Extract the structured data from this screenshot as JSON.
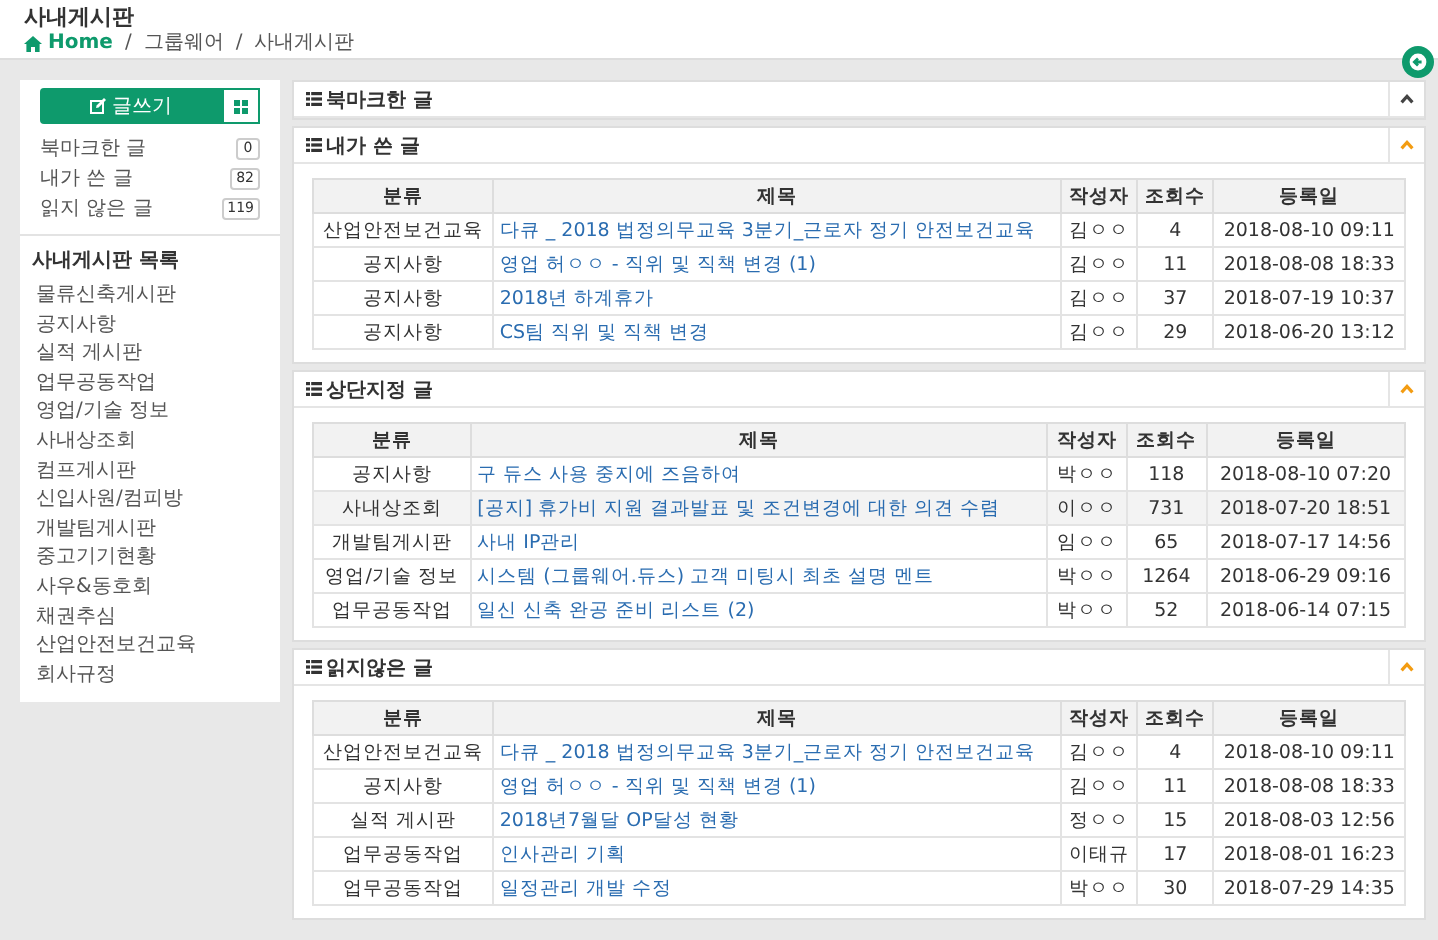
{
  "header": {
    "title": "사내게시판",
    "separator": "/",
    "breadcrumb": [
      {
        "label": "Home",
        "kind": "home"
      },
      {
        "label": "그룹웨어",
        "kind": "text"
      },
      {
        "label": "사내게시판",
        "kind": "text"
      }
    ]
  },
  "sidebar": {
    "write_button": "글쓰기",
    "counters": [
      {
        "label": "북마크한 글",
        "count": "0"
      },
      {
        "label": "내가 쓴 글",
        "count": "82"
      },
      {
        "label": "읽지 않은 글",
        "count": "119"
      }
    ],
    "board_list_title": "사내게시판 목록",
    "boards": [
      "물류신축게시판",
      "공지사항",
      "실적 게시판",
      "업무공동작업",
      "영업/기술 정보",
      "사내상조회",
      "컴프게시판",
      "신입사원/컴피방",
      "개발팀게시판",
      "중고기기현황",
      "사우&동호회",
      "채권추심",
      "산업안전보건교육",
      "회사규정"
    ]
  },
  "panels": [
    {
      "title": "북마크한 글",
      "expanded": false
    },
    {
      "title": "내가 쓴 글",
      "expanded": true,
      "table": {
        "columns": [
          "분류",
          "제목",
          "작성자",
          "조회수",
          "등록일"
        ],
        "rows": [
          {
            "selected": false,
            "cells": [
              "산업안전보건교육",
              "다큐 _ 2018 법정의무교육 3분기_근로자 정기 안전보건교육",
              "김ㅇㅇ",
              "4",
              "2018-08-10 09:11"
            ]
          },
          {
            "selected": false,
            "cells": [
              "공지사항",
              "영업 허ㅇㅇ - 직위 및 직책 변경 (1)",
              "김ㅇㅇ",
              "11",
              "2018-08-08 18:33"
            ]
          },
          {
            "selected": false,
            "cells": [
              "공지사항",
              "2018년 하계휴가",
              "김ㅇㅇ",
              "37",
              "2018-07-19 10:37"
            ]
          },
          {
            "selected": false,
            "cells": [
              "공지사항",
              "CS팀 직위 및 직책 변경",
              "김ㅇㅇ",
              "29",
              "2018-06-20 13:12"
            ]
          }
        ]
      }
    },
    {
      "title": "상단지정 글",
      "expanded": true,
      "table": {
        "columns": [
          "분류",
          "제목",
          "작성자",
          "조회수",
          "등록일"
        ],
        "rows": [
          {
            "selected": false,
            "cells": [
              "공지사항",
              "구 듀스 사용 중지에 즈음하여",
              "박ㅇㅇ",
              "118",
              "2018-08-10 07:20"
            ]
          },
          {
            "selected": true,
            "cells": [
              "사내상조회",
              "[공지] 휴가비 지원 결과발표 및 조건변경에 대한 의견 수렴",
              "이ㅇㅇ",
              "731",
              "2018-07-20 18:51"
            ]
          },
          {
            "selected": false,
            "cells": [
              "개발팀게시판",
              "사내 IP관리",
              "임ㅇㅇ",
              "65",
              "2018-07-17 14:56"
            ]
          },
          {
            "selected": false,
            "cells": [
              "영업/기술 정보",
              "시스템 (그룹웨어.듀스) 고객 미팅시 최초 설명 멘트",
              "박ㅇㅇ",
              "1264",
              "2018-06-29 09:16"
            ]
          },
          {
            "selected": false,
            "cells": [
              "업무공동작업",
              "일신 신축 완공 준비 리스트 (2)",
              "박ㅇㅇ",
              "52",
              "2018-06-14 07:15"
            ]
          }
        ]
      }
    },
    {
      "title": "읽지않은 글",
      "expanded": true,
      "table": {
        "columns": [
          "분류",
          "제목",
          "작성자",
          "조회수",
          "등록일"
        ],
        "rows": [
          {
            "selected": false,
            "cells": [
              "산업안전보건교육",
              "다큐 _ 2018 법정의무교육 3분기_근로자 정기 안전보건교육",
              "김ㅇㅇ",
              "4",
              "2018-08-10 09:11"
            ]
          },
          {
            "selected": false,
            "cells": [
              "공지사항",
              "영업 허ㅇㅇ - 직위 및 직책 변경 (1)",
              "김ㅇㅇ",
              "11",
              "2018-08-08 18:33"
            ]
          },
          {
            "selected": false,
            "cells": [
              "실적 게시판",
              "2018년7월달 OP달성 현황",
              "정ㅇㅇ",
              "15",
              "2018-08-03 12:56"
            ]
          },
          {
            "selected": false,
            "cells": [
              "업무공동작업",
              "인사관리 기획",
              "이태규",
              "17",
              "2018-08-01 16:23"
            ]
          },
          {
            "selected": false,
            "cells": [
              "업무공동작업",
              "일정관리 개발 수정",
              "박ㅇㅇ",
              "30",
              "2018-07-29 14:35"
            ]
          }
        ]
      }
    }
  ]
}
